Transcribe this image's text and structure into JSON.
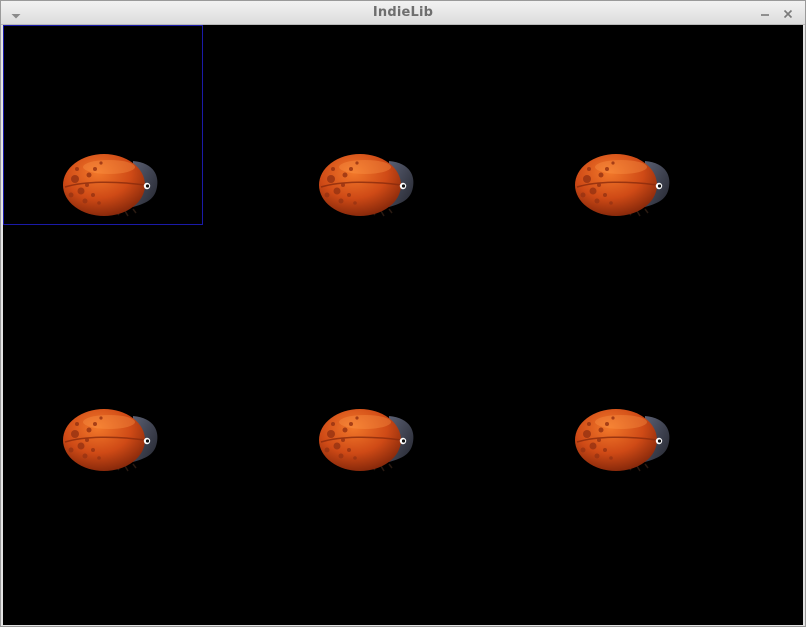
{
  "window": {
    "title": "IndieLib",
    "menu_icon": "chevron-down-icon",
    "minimize_icon": "minimize-icon",
    "close_icon": "close-icon"
  },
  "canvas": {
    "background": "#000000",
    "selection_color": "#1a1aa8",
    "sprite": "ladybug",
    "sprite_count": 6
  }
}
